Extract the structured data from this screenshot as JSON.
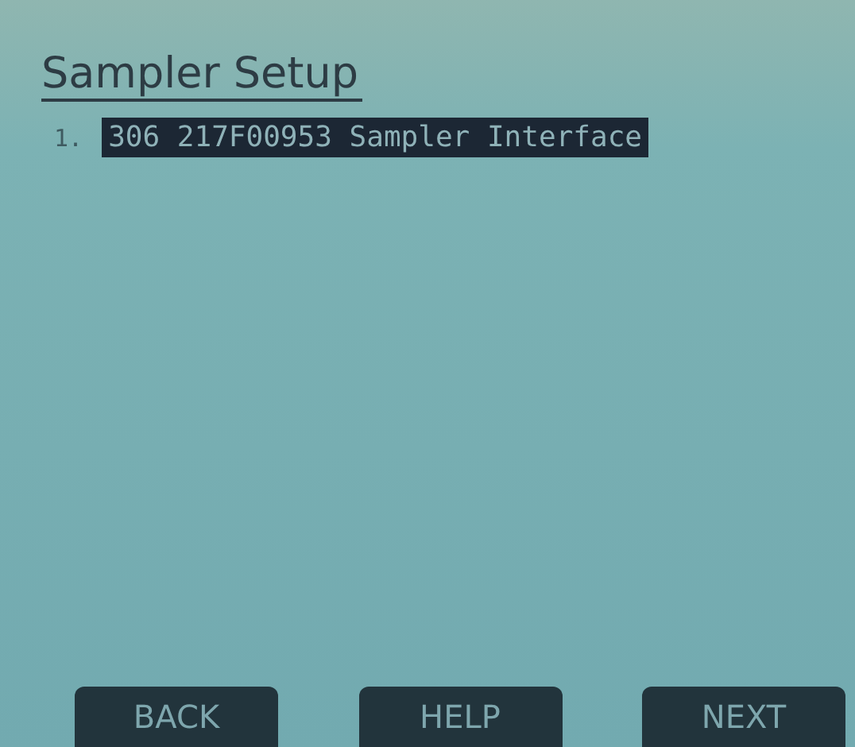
{
  "title": "Sampler Setup",
  "items": [
    {
      "number": "1.",
      "label": "306 217F00953 Sampler Interface",
      "selected": true
    }
  ],
  "buttons": [
    "BACK",
    "HELP",
    "NEXT"
  ]
}
